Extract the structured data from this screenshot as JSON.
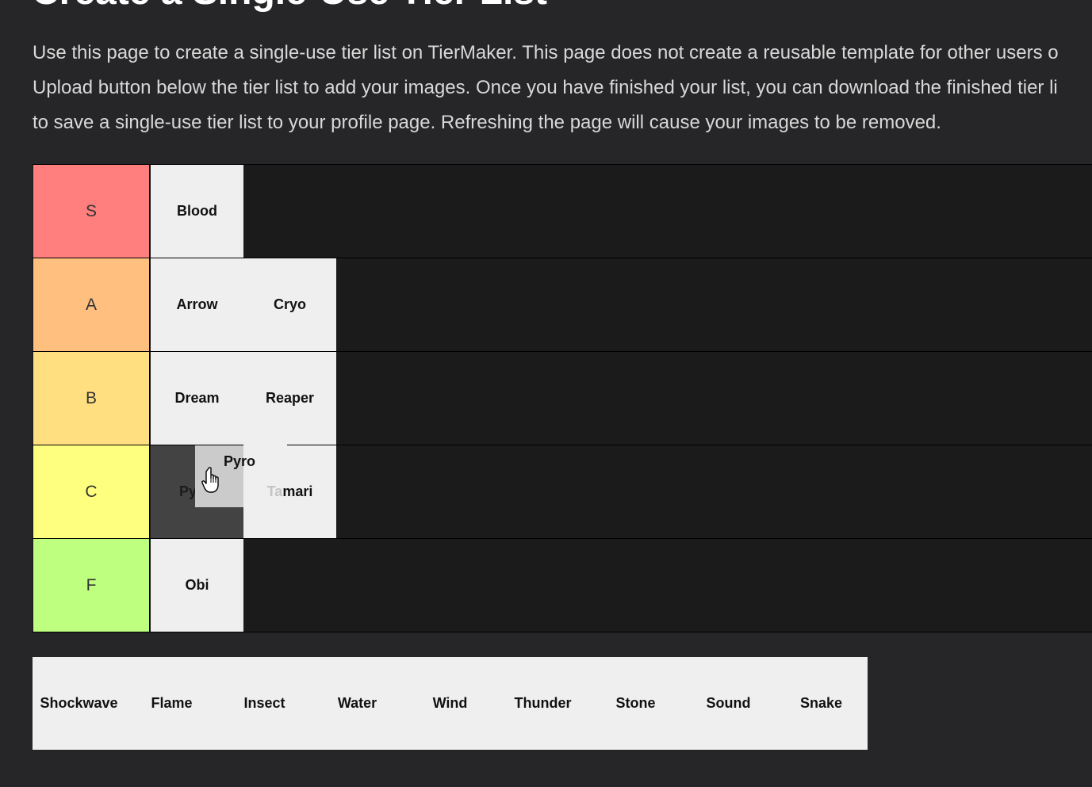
{
  "page": {
    "title": "Create a Single-Use Tier List",
    "intro_lines": [
      "Use this page to create a single-use tier list on TierMaker. This page does not create a reusable template for other users o",
      "Upload button below the tier list to add your images. Once you have finished your list, you can download the finished tier li",
      "to save a single-use tier list to your profile page. Refreshing the page will cause your images to be removed."
    ]
  },
  "tiers": [
    {
      "label": "S",
      "color": "#ff7f7f",
      "items": [
        "Blood"
      ]
    },
    {
      "label": "A",
      "color": "#ffbf7f",
      "items": [
        "Arrow",
        "Cryo"
      ]
    },
    {
      "label": "B",
      "color": "#ffdf7f",
      "items": [
        "Dream",
        "Reaper"
      ]
    },
    {
      "label": "C",
      "color": "#ffff7f",
      "items": [
        "Py",
        "Tamari"
      ]
    },
    {
      "label": "F",
      "color": "#bfff7f",
      "items": [
        "Obi"
      ]
    }
  ],
  "drag": {
    "label": "Pyro",
    "placeholder_text": "Py",
    "tamari_faded": "Ta",
    "tamari_rest": "mari"
  },
  "bank": {
    "items": [
      "Shockwave",
      "Flame",
      "Insect",
      "Water",
      "Wind",
      "Thunder",
      "Stone",
      "Sound",
      "Snake"
    ]
  },
  "colors": {
    "background": "#262527",
    "row_bg": "#1b1b1b",
    "item_bg": "#efefef"
  },
  "icons": {
    "cursor": "hand-pointer-icon"
  }
}
